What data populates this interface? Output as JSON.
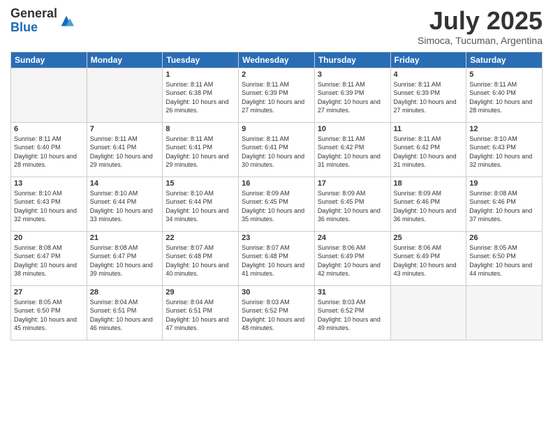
{
  "logo": {
    "general": "General",
    "blue": "Blue"
  },
  "title": "July 2025",
  "subtitle": "Simoca, Tucuman, Argentina",
  "days_header": [
    "Sunday",
    "Monday",
    "Tuesday",
    "Wednesday",
    "Thursday",
    "Friday",
    "Saturday"
  ],
  "weeks": [
    [
      {
        "day": "",
        "empty": true
      },
      {
        "day": "",
        "empty": true
      },
      {
        "day": "1",
        "sunrise": "8:11 AM",
        "sunset": "6:38 PM",
        "daylight": "10 hours and 26 minutes."
      },
      {
        "day": "2",
        "sunrise": "8:11 AM",
        "sunset": "6:39 PM",
        "daylight": "10 hours and 27 minutes."
      },
      {
        "day": "3",
        "sunrise": "8:11 AM",
        "sunset": "6:39 PM",
        "daylight": "10 hours and 27 minutes."
      },
      {
        "day": "4",
        "sunrise": "8:11 AM",
        "sunset": "6:39 PM",
        "daylight": "10 hours and 27 minutes."
      },
      {
        "day": "5",
        "sunrise": "8:11 AM",
        "sunset": "6:40 PM",
        "daylight": "10 hours and 28 minutes."
      }
    ],
    [
      {
        "day": "6",
        "sunrise": "8:11 AM",
        "sunset": "6:40 PM",
        "daylight": "10 hours and 28 minutes."
      },
      {
        "day": "7",
        "sunrise": "8:11 AM",
        "sunset": "6:41 PM",
        "daylight": "10 hours and 29 minutes."
      },
      {
        "day": "8",
        "sunrise": "8:11 AM",
        "sunset": "6:41 PM",
        "daylight": "10 hours and 29 minutes."
      },
      {
        "day": "9",
        "sunrise": "8:11 AM",
        "sunset": "6:41 PM",
        "daylight": "10 hours and 30 minutes."
      },
      {
        "day": "10",
        "sunrise": "8:11 AM",
        "sunset": "6:42 PM",
        "daylight": "10 hours and 31 minutes."
      },
      {
        "day": "11",
        "sunrise": "8:11 AM",
        "sunset": "6:42 PM",
        "daylight": "10 hours and 31 minutes."
      },
      {
        "day": "12",
        "sunrise": "8:10 AM",
        "sunset": "6:43 PM",
        "daylight": "10 hours and 32 minutes."
      }
    ],
    [
      {
        "day": "13",
        "sunrise": "8:10 AM",
        "sunset": "6:43 PM",
        "daylight": "10 hours and 32 minutes."
      },
      {
        "day": "14",
        "sunrise": "8:10 AM",
        "sunset": "6:44 PM",
        "daylight": "10 hours and 33 minutes."
      },
      {
        "day": "15",
        "sunrise": "8:10 AM",
        "sunset": "6:44 PM",
        "daylight": "10 hours and 34 minutes."
      },
      {
        "day": "16",
        "sunrise": "8:09 AM",
        "sunset": "6:45 PM",
        "daylight": "10 hours and 35 minutes."
      },
      {
        "day": "17",
        "sunrise": "8:09 AM",
        "sunset": "6:45 PM",
        "daylight": "10 hours and 36 minutes."
      },
      {
        "day": "18",
        "sunrise": "8:09 AM",
        "sunset": "6:46 PM",
        "daylight": "10 hours and 36 minutes."
      },
      {
        "day": "19",
        "sunrise": "8:08 AM",
        "sunset": "6:46 PM",
        "daylight": "10 hours and 37 minutes."
      }
    ],
    [
      {
        "day": "20",
        "sunrise": "8:08 AM",
        "sunset": "6:47 PM",
        "daylight": "10 hours and 38 minutes."
      },
      {
        "day": "21",
        "sunrise": "8:08 AM",
        "sunset": "6:47 PM",
        "daylight": "10 hours and 39 minutes."
      },
      {
        "day": "22",
        "sunrise": "8:07 AM",
        "sunset": "6:48 PM",
        "daylight": "10 hours and 40 minutes."
      },
      {
        "day": "23",
        "sunrise": "8:07 AM",
        "sunset": "6:48 PM",
        "daylight": "10 hours and 41 minutes."
      },
      {
        "day": "24",
        "sunrise": "8:06 AM",
        "sunset": "6:49 PM",
        "daylight": "10 hours and 42 minutes."
      },
      {
        "day": "25",
        "sunrise": "8:06 AM",
        "sunset": "6:49 PM",
        "daylight": "10 hours and 43 minutes."
      },
      {
        "day": "26",
        "sunrise": "8:05 AM",
        "sunset": "6:50 PM",
        "daylight": "10 hours and 44 minutes."
      }
    ],
    [
      {
        "day": "27",
        "sunrise": "8:05 AM",
        "sunset": "6:50 PM",
        "daylight": "10 hours and 45 minutes."
      },
      {
        "day": "28",
        "sunrise": "8:04 AM",
        "sunset": "6:51 PM",
        "daylight": "10 hours and 46 minutes."
      },
      {
        "day": "29",
        "sunrise": "8:04 AM",
        "sunset": "6:51 PM",
        "daylight": "10 hours and 47 minutes."
      },
      {
        "day": "30",
        "sunrise": "8:03 AM",
        "sunset": "6:52 PM",
        "daylight": "10 hours and 48 minutes."
      },
      {
        "day": "31",
        "sunrise": "8:03 AM",
        "sunset": "6:52 PM",
        "daylight": "10 hours and 49 minutes."
      },
      {
        "day": "",
        "empty": true
      },
      {
        "day": "",
        "empty": true
      }
    ]
  ],
  "labels": {
    "sunrise": "Sunrise:",
    "sunset": "Sunset:",
    "daylight": "Daylight:"
  }
}
